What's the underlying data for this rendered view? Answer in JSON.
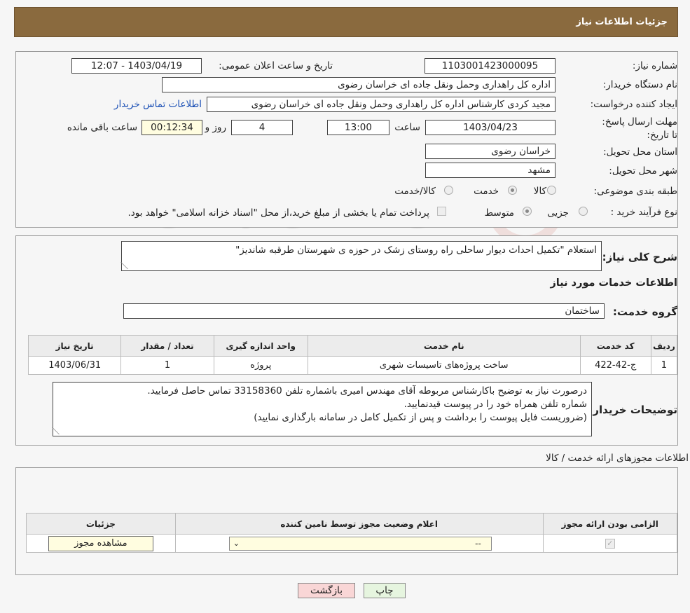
{
  "header": {
    "title": "جزئیات اطلاعات نیاز"
  },
  "need": {
    "number_label": "شماره نیاز:",
    "number": "1103001423000095",
    "announce_label": "تاریخ و ساعت اعلان عمومی:",
    "announce": "1403/04/19 - 12:07",
    "buyer_label": "نام دستگاه خریدار:",
    "buyer": "اداره کل راهداری وحمل ونقل جاده ای خراسان رضوی",
    "creator_label": "ایجاد کننده درخواست:",
    "creator": "مجید کردی کارشناس اداره کل راهداری وحمل ونقل جاده ای خراسان رضوی",
    "contact_link": "اطلاعات تماس خریدار",
    "deadline_label": "مهلت ارسال پاسخ: تا تاریخ:",
    "deadline_date": "1403/04/23",
    "time_label": "ساعت",
    "deadline_time": "13:00",
    "days": "4",
    "days_label": "روز و",
    "remaining": "00:12:34",
    "remaining_label": "ساعت باقی مانده",
    "province_label": "استان محل تحویل:",
    "province": "خراسان رضوی",
    "city_label": "شهر محل تحویل:",
    "city": "مشهد",
    "category_label": "طبقه بندی موضوعی:",
    "category_options": [
      "کالا",
      "خدمت",
      "کالا/خدمت"
    ],
    "process_label": "نوع فرآیند خرید :",
    "process_options": [
      "جزیی",
      "متوسط"
    ],
    "payment_note": "پرداخت تمام یا بخشی از مبلغ خرید،از محل \"اسناد خزانه اسلامی\" خواهد بود."
  },
  "summary": {
    "label": "شرح کلی نیاز:",
    "text": "استعلام \"تکمیل احداث دیوار ساحلی راه روستای زشک در حوزه ی شهرستان طرقبه شاندیز\""
  },
  "services": {
    "title": "اطلاعات خدمات مورد نیاز",
    "group_label": "گروه خدمت:",
    "group": "ساختمان",
    "columns": [
      "ردیف",
      "کد خدمت",
      "نام خدمت",
      "واحد اندازه گیری",
      "تعداد / مقدار",
      "تاریخ نیاز"
    ],
    "rows": [
      [
        "1",
        "ج-42-422",
        "ساخت پروژه‌های تاسیسات شهری",
        "پروژه",
        "1",
        "1403/06/31"
      ]
    ]
  },
  "buyer_notes": {
    "label": "توضیحات خریدار:",
    "lines": [
      "درصورت نیاز به توضیح باکارشناس مربوطه آقای مهندس امیری باشماره تلفن 33158360 تماس حاصل فرمایید.",
      "شماره تلفن همراه خود را در پیوست قیدنمایید.",
      "(ضروریست فایل پیوست را برداشت و پس از تکمیل کامل در سامانه بارگذاری نمایید)"
    ]
  },
  "permits": {
    "title": "اطلاعات مجوزهای ارائه خدمت / کالا",
    "columns": [
      "الزامی بودن ارائه مجوز",
      "اعلام وضعیت مجوز توسط نامین کننده",
      "جزئیات"
    ],
    "select_value": "--",
    "view_button": "مشاهده مجوز"
  },
  "footer": {
    "print": "چاپ",
    "back": "بازگشت"
  },
  "watermark": "AriaTender.neT",
  "colors": {
    "header": "#8a6a3e",
    "link": "#1a4fb5",
    "back_button": "#f9d6d6",
    "print_button": "#e6f5df"
  }
}
